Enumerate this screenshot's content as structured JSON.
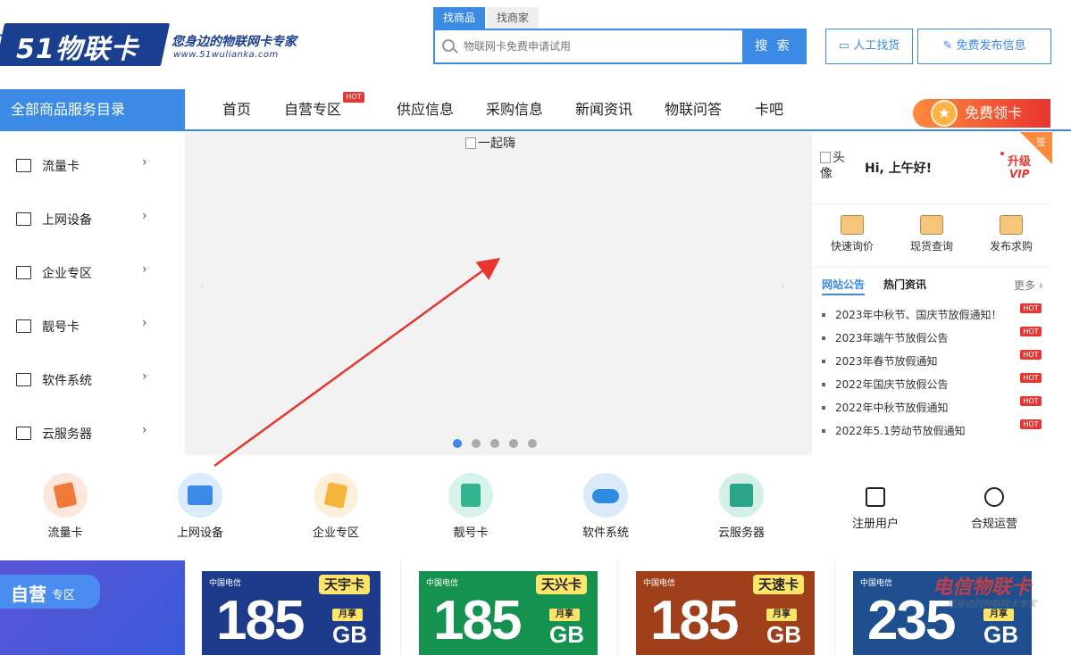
{
  "header": {
    "logo": {
      "mark": "51物联卡",
      "slogan": "您身边的物联网卡专家",
      "url": "www.51wulianka.com"
    },
    "search_tabs": [
      "找商品",
      "找商家"
    ],
    "search": {
      "placeholder": "物联网卡免费申请试用",
      "button": "搜 索"
    },
    "manual_button": "人工找货",
    "publish_button": "免费发布信息"
  },
  "nav": {
    "all_categories": "全部商品服务目录",
    "items": [
      "首页",
      "自营专区",
      "供应信息",
      "采购信息",
      "新闻资讯",
      "物联问答",
      "卡吧"
    ],
    "hot_badge": "HOT",
    "free_card": "免费领卡"
  },
  "sidebar": {
    "items": [
      {
        "label": "流量卡"
      },
      {
        "label": "上网设备"
      },
      {
        "label": "企业专区"
      },
      {
        "label": "靓号卡"
      },
      {
        "label": "软件系统"
      },
      {
        "label": "云服务器"
      }
    ]
  },
  "banner": {
    "alt": "一起嗨",
    "active_slide": 1,
    "slide_count": 5
  },
  "user_panel": {
    "avatar_alt": "头像",
    "greeting": "Hi, 上午好!",
    "upgrade": "升级",
    "vip": "VIP",
    "sign": "签",
    "quick_links": [
      "快速询价",
      "现货查询",
      "发布求购"
    ],
    "notice_tabs": [
      "网站公告",
      "热门资讯"
    ],
    "more": "更多",
    "notices": [
      "2023年中秋节、国庆节放假通知！",
      "2023年端午节放假公告",
      "2023年春节放假通知",
      "2022年国庆节放假公告",
      "2022年中秋节放假通知",
      "2022年5.1劳动节放假通知"
    ],
    "hot_label": "HOT"
  },
  "categories": [
    "流量卡",
    "上网设备",
    "企业专区",
    "靓号卡",
    "软件系统",
    "云服务器"
  ],
  "account": [
    "注册用户",
    "合规运营"
  ],
  "promo": {
    "zone_title": "自营",
    "zone_sub": "专区",
    "cards": [
      {
        "top": "中国电信",
        "name": "天宇卡",
        "num": "185",
        "tag": "月享",
        "unit": "GB",
        "color": "#1e3a8a"
      },
      {
        "top": "中国电信",
        "name": "天兴卡",
        "num": "185",
        "tag": "月享",
        "unit": "GB",
        "color": "#15924f"
      },
      {
        "top": "中国电信",
        "name": "天速卡",
        "num": "185",
        "tag": "月享",
        "unit": "GB",
        "color": "#a0401a"
      },
      {
        "top": "中国电信",
        "name": "",
        "num": "235",
        "tag": "月享",
        "unit": "GB",
        "color": "#1f4f8f"
      }
    ],
    "watermark": "电信物联卡",
    "watermark_sub": "您身边的物联网卡专家"
  },
  "colors": {
    "accent": "#3b8be6",
    "hot": "#e8352f",
    "orange": "#ff8a3d"
  }
}
